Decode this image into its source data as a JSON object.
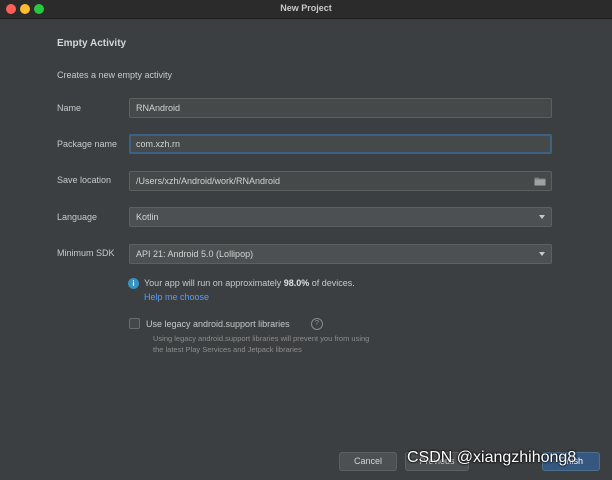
{
  "window": {
    "title": "New Project"
  },
  "page": {
    "heading": "Empty Activity",
    "description": "Creates a new empty activity"
  },
  "form": {
    "name": {
      "label": "Name",
      "value": "RNAndroid"
    },
    "package_name": {
      "label": "Package name",
      "value": "com.xzh.rn"
    },
    "save_location": {
      "label": "Save location",
      "value": "/Users/xzh/Android/work/RNAndroid"
    },
    "language": {
      "label": "Language",
      "value": "Kotlin"
    },
    "minimum_sdk": {
      "label": "Minimum SDK",
      "value": "API 21: Android 5.0 (Lollipop)"
    }
  },
  "info": {
    "icon": "info-icon",
    "text_before": "Your app will run on approximately ",
    "percent": "98.0%",
    "text_after": " of devices.",
    "help_link": "Help me choose"
  },
  "legacy": {
    "label": "Use legacy android.support libraries",
    "checked": false,
    "help_line1": "Using legacy android.support libraries will prevent you from using",
    "help_line2": "the latest Play Services and Jetpack libraries"
  },
  "buttons": {
    "cancel": "Cancel",
    "previous": "Previous",
    "finish": "Finish"
  },
  "watermark": "CSDN @xiangzhihong8",
  "colors": {
    "background": "#3c3f41",
    "focus_border": "#3d6185",
    "link": "#589df6",
    "info_icon": "#3592c4",
    "primary_button": "#365880"
  }
}
